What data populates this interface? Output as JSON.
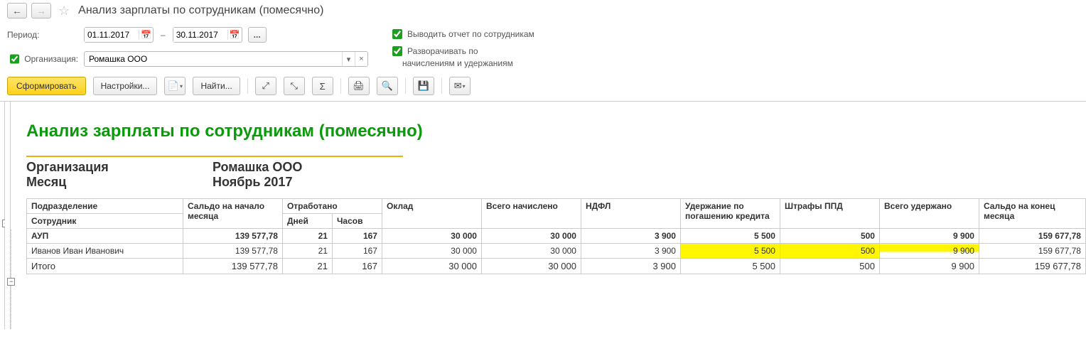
{
  "header": {
    "title": "Анализ зарплаты по сотрудникам (помесячно)"
  },
  "period": {
    "label": "Период:",
    "from": "01.11.2017",
    "to": "30.11.2017"
  },
  "org": {
    "label": "Организация:",
    "value": "Ромашка ООО"
  },
  "checks": {
    "report_by_employees": "Выводить отчет по сотрудникам",
    "expand_by": "Разворачивать по",
    "expand_sub": "начислениям и удержаниям"
  },
  "toolbar": {
    "form": "Сформировать",
    "settings": "Настройки...",
    "find": "Найти..."
  },
  "report": {
    "title": "Анализ зарплаты по сотрудникам (помесячно)",
    "meta": {
      "org_label": "Организация",
      "org_value": "Ромашка ООО",
      "month_label": "Месяц",
      "month_value": "Ноябрь 2017"
    },
    "columns": {
      "division": "Подразделение",
      "employee": "Сотрудник",
      "start_balance": "Сальдо на начало месяца",
      "worked": "Отработано",
      "days": "Дней",
      "hours": "Часов",
      "salary": "Оклад",
      "accrued_total": "Всего начислено",
      "ndfl": "НДФЛ",
      "loan": "Удержание по погашению кредита",
      "fines": "Штрафы ППД",
      "withheld_total": "Всего удержано",
      "end_balance": "Сальдо на конец месяца"
    },
    "rows": {
      "dept": {
        "name": "АУП",
        "start": "139 577,78",
        "days": "21",
        "hours": "167",
        "salary": "30 000",
        "accrued": "30 000",
        "ndfl": "3 900",
        "loan": "5 500",
        "fines": "500",
        "withheld": "9 900",
        "end": "159 677,78"
      },
      "emp": {
        "name": "Иванов Иван Иванович",
        "start": "139 577,78",
        "days": "21",
        "hours": "167",
        "salary": "30 000",
        "accrued": "30 000",
        "ndfl": "3 900",
        "loan": "5 500",
        "fines": "500",
        "withheld": "9 900",
        "end": "159 677,78"
      },
      "total": {
        "name": "Итого",
        "start": "139 577,78",
        "days": "21",
        "hours": "167",
        "salary": "30 000",
        "accrued": "30 000",
        "ndfl": "3 900",
        "loan": "5 500",
        "fines": "500",
        "withheld": "9 900",
        "end": "159 677,78"
      }
    }
  }
}
